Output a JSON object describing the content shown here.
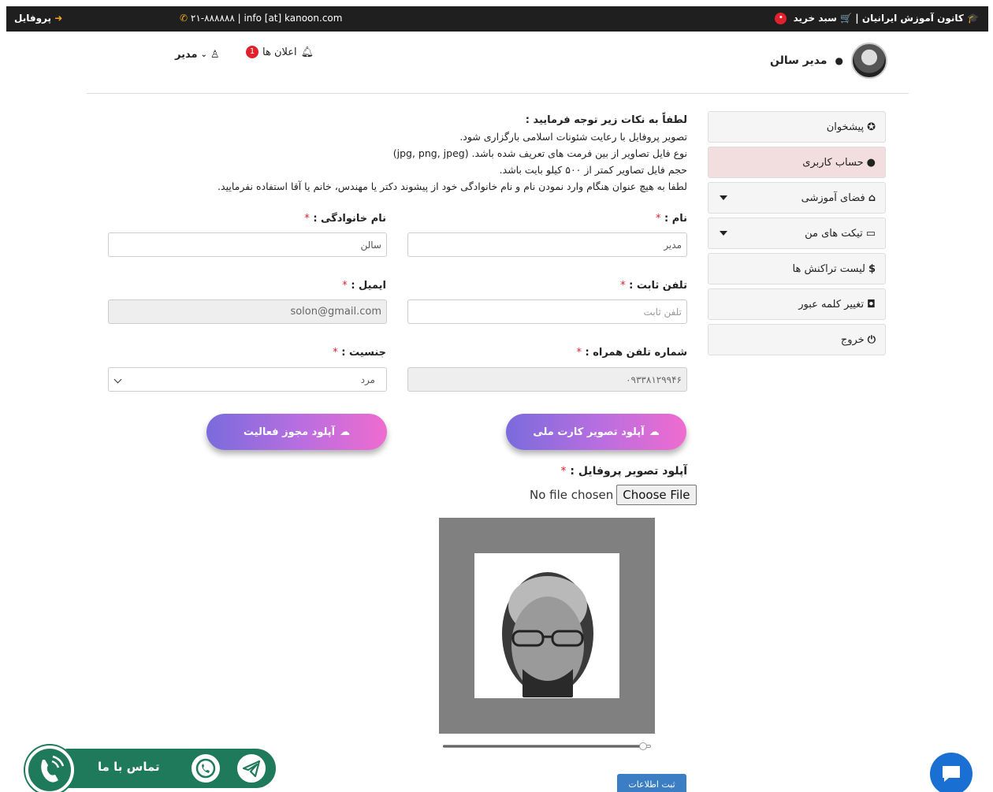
{
  "topbar": {
    "brand": "کانون آموزش ایرانیان",
    "separator": "|",
    "cart": "سبد خرید",
    "cart_count": "•",
    "contact": "۲۱-۸۸۸۸۸۸ | info [at] kanoon.com",
    "profile": "پروفایل"
  },
  "header": {
    "user_name": "مدیر سالن",
    "notifications_label": "اعلان ها",
    "notifications_count": "1",
    "user_menu": "مدیر"
  },
  "sidebar": {
    "items": [
      {
        "icon": "dashboard-icon",
        "glyph": "✪",
        "label": "پیشخوان"
      },
      {
        "icon": "user-icon",
        "glyph": "●",
        "label": "حساب کاربری"
      },
      {
        "icon": "home-icon",
        "glyph": "⌂",
        "label": "فضای آموزشی"
      },
      {
        "icon": "inbox-icon",
        "glyph": "▭",
        "label": "تیکت های من"
      },
      {
        "icon": "dollar-icon",
        "glyph": "$",
        "label": "لیست تراکنش ها"
      },
      {
        "icon": "lock-icon",
        "glyph": "◘",
        "label": "تغییر کلمه عبور"
      },
      {
        "icon": "power-icon",
        "glyph": "⏻",
        "label": "خروج"
      }
    ]
  },
  "notes": {
    "heading": "لطفاً به نکات زیر توجه فرمایید :",
    "lines": [
      "تصویر پروفایل با رعایت شئونات اسلامی بارگزاری شود.",
      "نوع فایل تصاویر از بین فرمت های تعریف شده باشد. (jpg, png, jpeg)",
      "حجم فایل تصاویر کمتر از ۵۰۰ کیلو بایت باشد.",
      "لطفا به هیچ عنوان هنگام وارد نمودن نام و نام خانوادگی خود از پیشوند دکتر یا مهندس، خانم یا آقا استفاده نفرمایید."
    ]
  },
  "form": {
    "required_mark": "*",
    "first_name_label": "نام :",
    "first_name_value": "مدیر",
    "last_name_label": "نام خانوادگی :",
    "last_name_value": "سالن",
    "phone_label": "تلفن ثابت :",
    "phone_placeholder": "تلفن ثابت",
    "email_label": "ایمیل :",
    "email_value": "solon@gmail.com",
    "mobile_label": "شماره تلفن همراه :",
    "mobile_value": "۰۹۳۳۸۱۲۹۹۴۶",
    "gender_label": "جنسیت :",
    "gender_value": "مرد",
    "upload_national_card": "آپلود تصویر کارت ملی",
    "upload_license": "آپلود مجوز فعالیت",
    "profile_image_label": "آپلود تصویر پروفایل :",
    "file_status": "No file chosen",
    "choose_file": "Choose File",
    "zoom_level": 0.97,
    "submit": "ثبت اطلاعات"
  },
  "widget": {
    "contact_us": "تماس با ما"
  },
  "colors": {
    "topbar": "#1f1f1f",
    "accent_orange": "#f5a623",
    "badge_red": "#e0202a",
    "active_item": "#f2dede",
    "submit_blue": "#3b7ec4",
    "widget_green": "#1f7a5b",
    "chat_blue": "#1a6fd3"
  }
}
